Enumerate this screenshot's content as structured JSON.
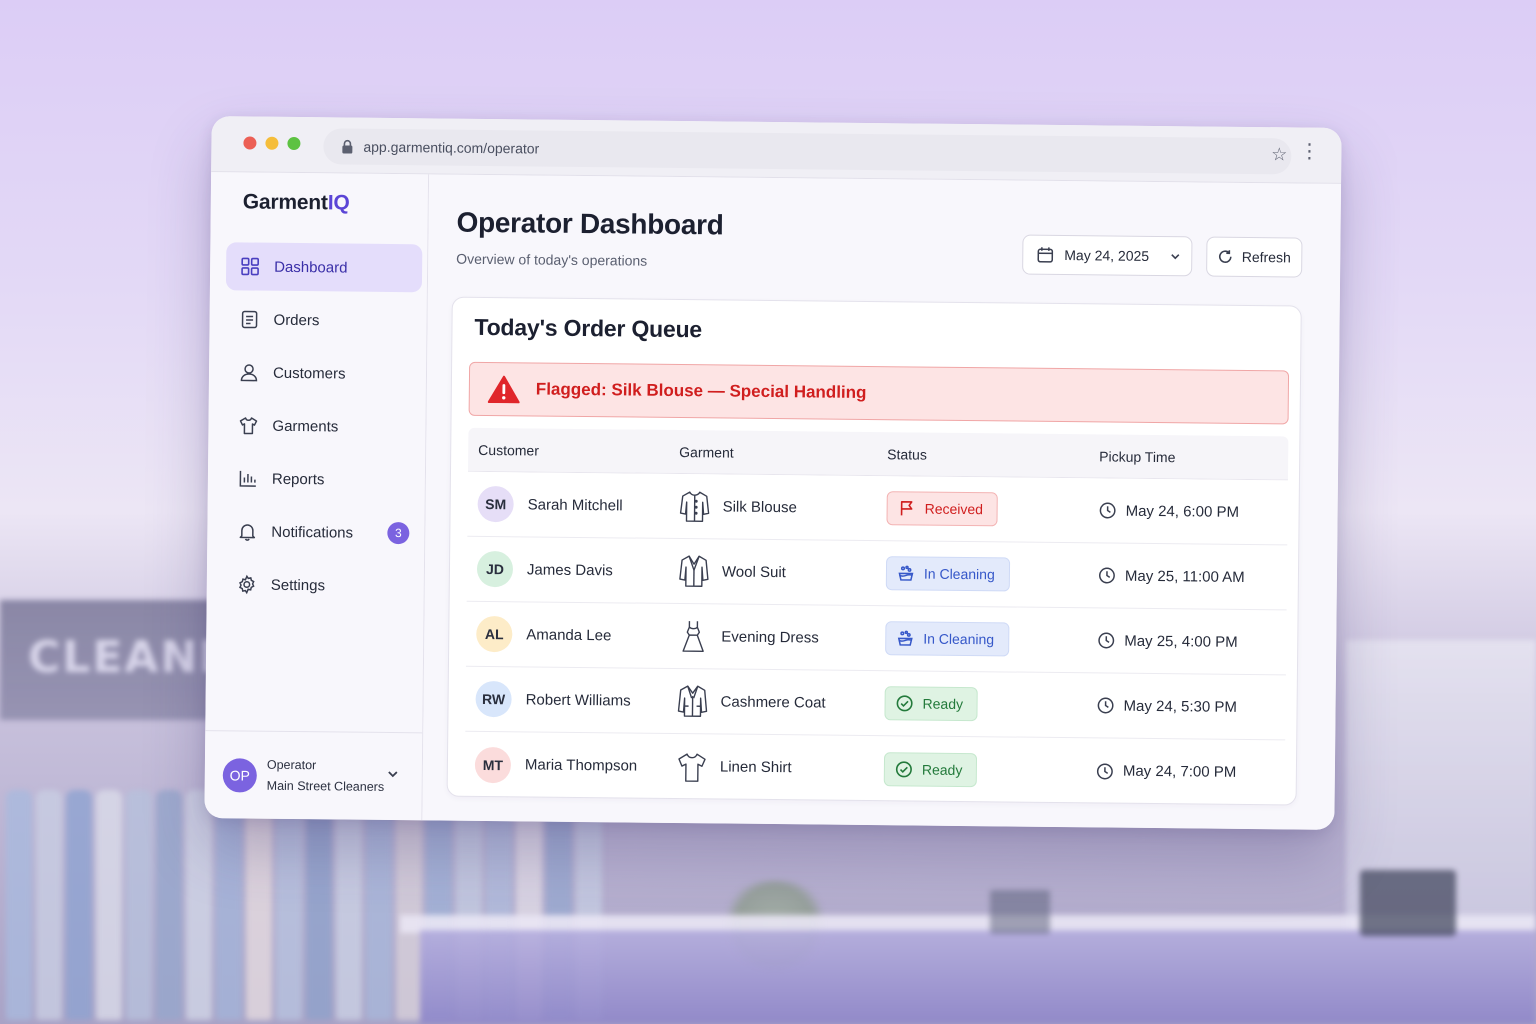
{
  "background": {
    "sign_text": "CLEANER"
  },
  "browser": {
    "url": "app.garmentiq.com/operator"
  },
  "sidebar": {
    "logo": {
      "part1": "Garment",
      "part2": "IQ",
      "accent": "#5b45d6"
    },
    "items": [
      {
        "label": "Dashboard",
        "icon": "grid-icon",
        "active": true
      },
      {
        "label": "Orders",
        "icon": "clipboard-icon"
      },
      {
        "label": "Customers",
        "icon": "user-icon"
      },
      {
        "label": "Garments",
        "icon": "shirt-icon"
      },
      {
        "label": "Reports",
        "icon": "bar-chart-icon"
      },
      {
        "label": "Notifications",
        "icon": "bell-icon",
        "badge": "3"
      },
      {
        "label": "Settings",
        "icon": "gear-icon"
      }
    ],
    "user": {
      "initials": "OP",
      "role": "Operator",
      "store": "Main Street Cleaners"
    }
  },
  "header": {
    "title": "Operator Dashboard",
    "subtitle": "Overview of today's operations",
    "date": "May 24, 2025",
    "refresh_label": "Refresh"
  },
  "queue": {
    "title": "Today's Order Queue",
    "alert": "Flagged: Silk Blouse — Special Handling",
    "columns": [
      "Customer",
      "Garment",
      "Status",
      "Pickup Time"
    ],
    "rows": [
      {
        "initials": "SM",
        "avatar_color": "#e6def7",
        "customer": "Sarah Mitchell",
        "garment": "Silk Blouse",
        "garment_icon": "blouse-icon",
        "status": "Received",
        "status_type": "received",
        "pickup": "May 24, 6:00 PM"
      },
      {
        "initials": "JD",
        "avatar_color": "#d7f0df",
        "customer": "James Davis",
        "garment": "Wool Suit",
        "garment_icon": "suit-icon",
        "status": "In Cleaning",
        "status_type": "cleaning",
        "pickup": "May 25, 11:00 AM"
      },
      {
        "initials": "AL",
        "avatar_color": "#fdecc8",
        "customer": "Amanda Lee",
        "garment": "Evening Dress",
        "garment_icon": "dress-icon",
        "status": "In Cleaning",
        "status_type": "cleaning",
        "pickup": "May 25, 4:00 PM"
      },
      {
        "initials": "RW",
        "avatar_color": "#d8e6fb",
        "customer": "Robert Williams",
        "garment": "Cashmere Coat",
        "garment_icon": "coat-icon",
        "status": "Ready",
        "status_type": "ready",
        "pickup": "May 24, 5:30 PM"
      },
      {
        "initials": "MT",
        "avatar_color": "#fbdcdc",
        "customer": "Maria Thompson",
        "garment": "Linen Shirt",
        "garment_icon": "shirt-icon",
        "status": "Ready",
        "status_type": "ready",
        "pickup": "May 24, 7:00 PM"
      }
    ]
  },
  "status_colors": {
    "received": {
      "bg": "#fde4e4",
      "fg": "#d01e1e",
      "border": "#f3b3b3"
    },
    "cleaning": {
      "bg": "#e3eafb",
      "fg": "#3658c9",
      "border": "#cfdaf6"
    },
    "ready": {
      "bg": "#dff3e3",
      "fg": "#237a3b",
      "border": "#c6e8ce"
    }
  }
}
